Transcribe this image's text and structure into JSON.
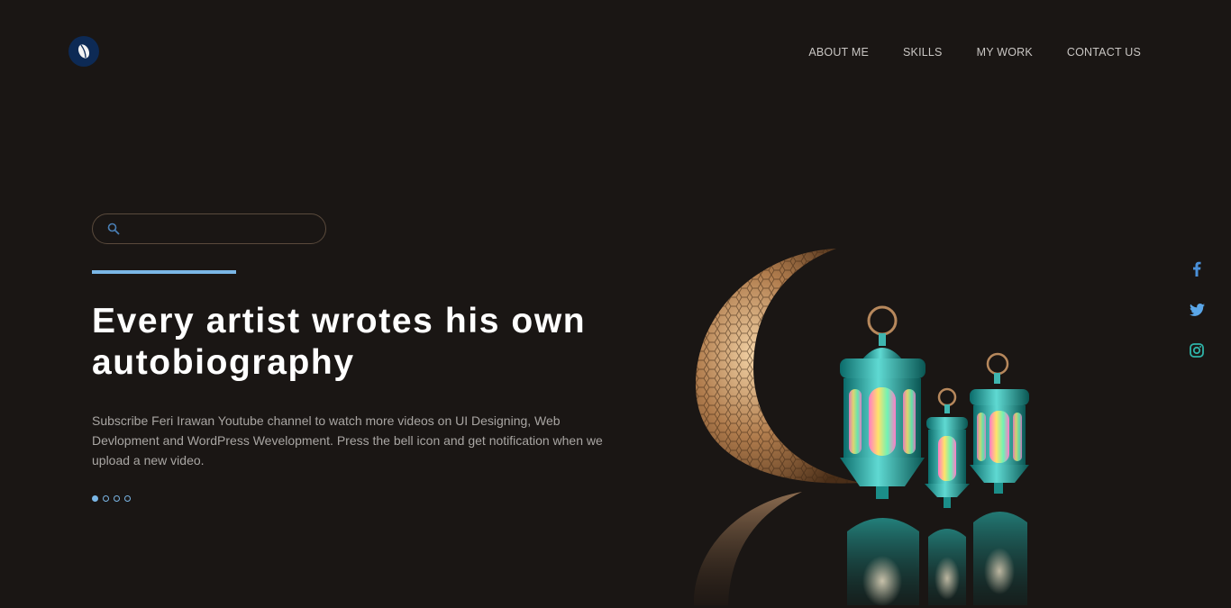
{
  "nav": {
    "items": [
      {
        "label": "ABOUT ME"
      },
      {
        "label": "SKILLS"
      },
      {
        "label": "MY WORK"
      },
      {
        "label": "CONTACT US"
      }
    ]
  },
  "search": {
    "placeholder": "",
    "value": ""
  },
  "hero": {
    "headline_line1": "Every artist wrotes his own",
    "headline_line2": "autobiography",
    "description": "Subscribe Feri Irawan Youtube channel to watch more videos on UI Designing, Web Devlopment and WordPress Wevelopment. Press the bell icon and get notification when we upload a new video."
  },
  "slider": {
    "count": 4,
    "active_index": 0
  },
  "social": {
    "icons": [
      "facebook-icon",
      "twitter-icon",
      "instagram-icon"
    ]
  },
  "colors": {
    "accent": "#7ab6e6",
    "background": "#1a1614",
    "logo": "#0d2a55"
  }
}
